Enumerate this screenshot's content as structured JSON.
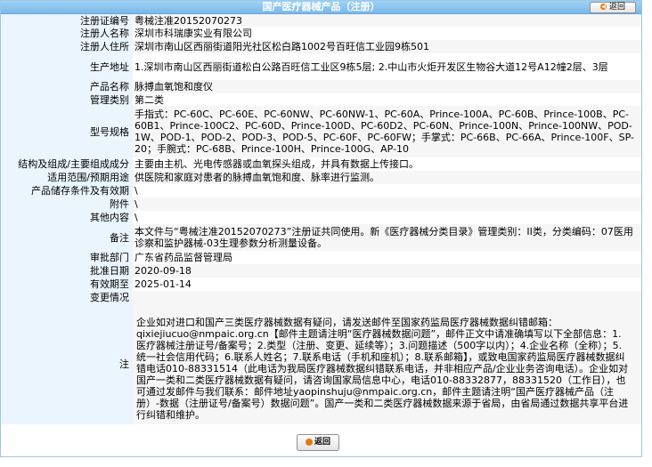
{
  "header": {
    "title": "国产医疗器械产品（注册）",
    "back_label": "返回"
  },
  "fields": [
    {
      "label": "注册证编号",
      "value": "粤械注准20152070273"
    },
    {
      "label": "注册人名称",
      "value": "深圳市科瑞康实业有限公司"
    },
    {
      "label": "注册人住所",
      "value": "深圳市南山区西丽街道阳光社区松白路1002号百旺信工业园9栋501"
    },
    {
      "label": "生产地址",
      "value": "1.深圳市南山区西丽街道松白公路百旺信工业区9栋5层; 2.中山市火炬开发区生物谷大道12号A12幢2层、3层"
    },
    {
      "label": "产品名称",
      "value": "脉搏血氧饱和度仪"
    },
    {
      "label": "管理类别",
      "value": "第二类"
    },
    {
      "label": "型号规格",
      "value": "手指式：PC-60C、PC-60E、PC-60NW、PC-60NW-1、PC-60A、Prince-100A、PC-60B、Prince-100B、PC-60B1、Prince-100C2、PC-60D、Prince-100D、PC-60D2、PC-60N、Prince-100N、Prince-100NW、POD-1W、POD-1、POD-2、POD-3、POD-5、PC-60F、PC-60FW；手掌式：PC-66B、PC-66A、Prince-100F、SP-20；手腕式：PC-68B、Prince-100H、Prince-100G、AP-10"
    },
    {
      "label": "结构及组成/主要组成成分",
      "value": "主要由主机、光电传感器或血氧探头组成，并具有数据上传接口。"
    },
    {
      "label": "适用范围/预期用途",
      "value": "供医院和家庭对患者的脉搏血氧饱和度、脉率进行监测。"
    },
    {
      "label": "产品储存条件及有效期",
      "value": "\\"
    },
    {
      "label": "附件",
      "value": "\\"
    },
    {
      "label": "其他内容",
      "value": "\\"
    },
    {
      "label": "备注",
      "value": "本文件与“粤械注准20152070273”注册证共同使用。新《医疗器械分类目录》管理类别：II类，分类编码：07医用诊察和监护器械-03生理参数分析测量设备。"
    },
    {
      "label": "审批部门",
      "value": "广东省药品监督管理局"
    },
    {
      "label": "批准日期",
      "value": "2020-09-18"
    },
    {
      "label": "有效期至",
      "value": "2025-01-14"
    },
    {
      "label": "变更情况",
      "value": ""
    }
  ],
  "notice": {
    "label": "注",
    "text": "企业如对进口和国产三类医疗器械数据有疑问，请发送邮件至国家药监局医疗器械数据纠错邮箱：qixiejiucuo@nmpaic.org.cn【邮件主题请注明“医疗器械数据问题”，邮件正文中请准确填写以下全部信息：1.医疗器械注册证号/备案号；2.类型（注册、变更、延续等）；3.问题描述（500字以内）；4.企业名称（全称）；5.统一社会信用代码；6.联系人姓名；7.联系电话（手机和座机）；8.联系邮箱】，或致电国家药监局医疗器械数据纠错电话010-88331514（此电话为我局医疗器械数据纠错联系电话，并非相应产品/企业业务咨询电话）。企业如对国产一类和二类医疗器械数据有疑问，请咨询国家局信息中心，电话010-88332877，88331520（工作日），也可通过发邮件与我们联系：邮件地址yaopinshuju@nmpaic.org.cn，邮件主题请注明“国产医疗器械产品（注册）-数据（注册证号/备案号）数据问题”。国产一类和二类医疗器械数据来源于省局，由省局通过数据共享平台进行纠错和维护。"
  },
  "footer": {
    "back_label": "返回"
  },
  "colors": {
    "header_bg": "#8cc6f0",
    "label_bg": "#eaf5fd",
    "stripe_bg": "#f6f6f6",
    "back_dot": "#e07a10"
  }
}
